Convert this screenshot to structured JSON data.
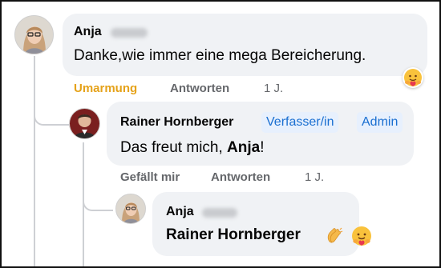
{
  "comment1": {
    "author": "Anja",
    "text": "Danke,wie immer eine mega Bereicherung.",
    "actions": {
      "reaction_label": "Umarmung",
      "reply": "Antworten",
      "time": "1 J."
    },
    "reaction_label_color": "#e5a21a",
    "reaction_icon": "care-hug-emoji"
  },
  "reply1": {
    "author": "Rainer Hornberger",
    "badges": [
      "Verfasser/in",
      "Admin"
    ],
    "text_prefix": "Das freut mich, ",
    "text_mention": "Anja",
    "text_suffix": "!",
    "actions": {
      "like": "Gefällt mir",
      "reply": "Antworten",
      "time": "1 J."
    }
  },
  "reply2": {
    "author": "Anja",
    "mention": "Rainer Hornberger",
    "emojis": [
      "clapping-hands-emoji",
      "care-hug-emoji"
    ]
  },
  "colors": {
    "bubble": "#f0f2f5",
    "badge_bg": "#e7f0fd",
    "badge_text": "#1a6fd1",
    "meta": "#65676b"
  }
}
